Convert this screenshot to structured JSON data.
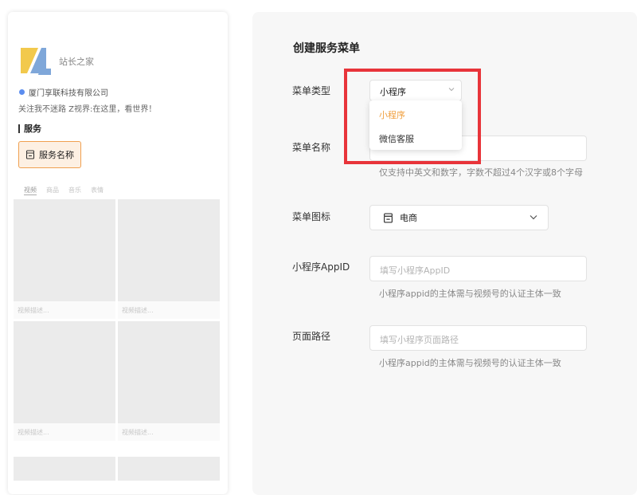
{
  "preview": {
    "brand_name": "站长之家",
    "company": "厦门享联科技有限公司",
    "slogan": "关注我不迷路 Z视界:在这里，看世界！",
    "services_heading": "服务",
    "service_button": "服务名称",
    "tabs": [
      "视频",
      "商品",
      "音乐",
      "表情"
    ],
    "video_caption": "视频描述..."
  },
  "form": {
    "title": "创建服务菜单",
    "menu_type_label": "菜单类型",
    "menu_type_value": "小程序",
    "menu_type_options": [
      "小程序",
      "微信客服"
    ],
    "menu_name_label": "菜单名称",
    "menu_name_hint": "仅支持中英文和数字，字数不超过4个汉字或8个字母",
    "menu_icon_label": "菜单图标",
    "menu_icon_value": "电商",
    "appid_label": "小程序AppID",
    "appid_placeholder": "填写小程序AppID",
    "appid_hint": "小程序appid的主体需与视频号的认证主体一致",
    "path_label": "页面路径",
    "path_placeholder": "填写小程序页面路径",
    "path_hint": "小程序appid的主体需与视频号的认证主体一致"
  },
  "colors": {
    "accent": "#f0a040",
    "highlight": "#e8343a",
    "verify": "#5b8def"
  }
}
